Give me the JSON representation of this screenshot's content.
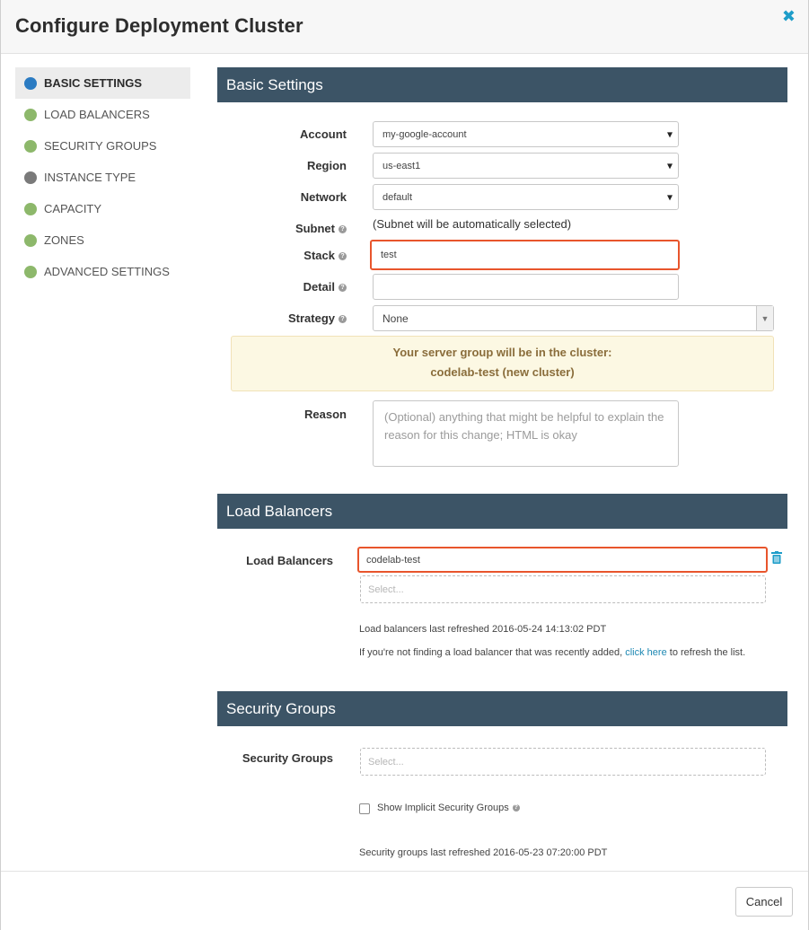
{
  "header": {
    "title": "Configure Deployment Cluster",
    "close_glyph": "✖"
  },
  "nav": {
    "items": [
      {
        "label": "BASIC SETTINGS",
        "status": "blue"
      },
      {
        "label": "LOAD BALANCERS",
        "status": "green"
      },
      {
        "label": "SECURITY GROUPS",
        "status": "green"
      },
      {
        "label": "INSTANCE TYPE",
        "status": "gray"
      },
      {
        "label": "CAPACITY",
        "status": "green"
      },
      {
        "label": "ZONES",
        "status": "green"
      },
      {
        "label": "ADVANCED SETTINGS",
        "status": "green"
      }
    ]
  },
  "basic": {
    "title": "Basic Settings",
    "account_label": "Account",
    "account_value": "my-google-account",
    "region_label": "Region",
    "region_value": "us-east1",
    "network_label": "Network",
    "network_value": "default",
    "subnet_label": "Subnet",
    "subnet_text": "(Subnet will be automatically selected)",
    "stack_label": "Stack",
    "stack_value": "test",
    "detail_label": "Detail",
    "detail_value": "",
    "strategy_label": "Strategy",
    "strategy_value": "None",
    "cluster_note_line1": "Your server group will be in the cluster:",
    "cluster_note_line2": "codelab-test (new cluster)",
    "reason_label": "Reason",
    "reason_placeholder": "(Optional) anything that might be helpful to explain the reason for this change; HTML is okay"
  },
  "load_balancers": {
    "title": "Load Balancers",
    "label": "Load Balancers",
    "selected": "codelab-test",
    "select_placeholder": "Select...",
    "refreshed_text": "Load balancers last refreshed 2016-05-24 14:13:02 PDT",
    "hint_prefix": "If you're not finding a load balancer that was recently added, ",
    "hint_link": "click here",
    "hint_suffix": " to refresh the list."
  },
  "security_groups": {
    "title": "Security Groups",
    "label": "Security Groups",
    "select_placeholder": "Select...",
    "implicit_label": "Show Implicit Security Groups",
    "refreshed_text": "Security groups last refreshed 2016-05-23 07:20:00 PDT"
  },
  "footer": {
    "cancel_label": "Cancel"
  },
  "colors": {
    "section_bar": "#3c5466",
    "highlight": "#e8552c",
    "active_dot": "#2b7bc2",
    "ok_dot": "#8db86b"
  }
}
